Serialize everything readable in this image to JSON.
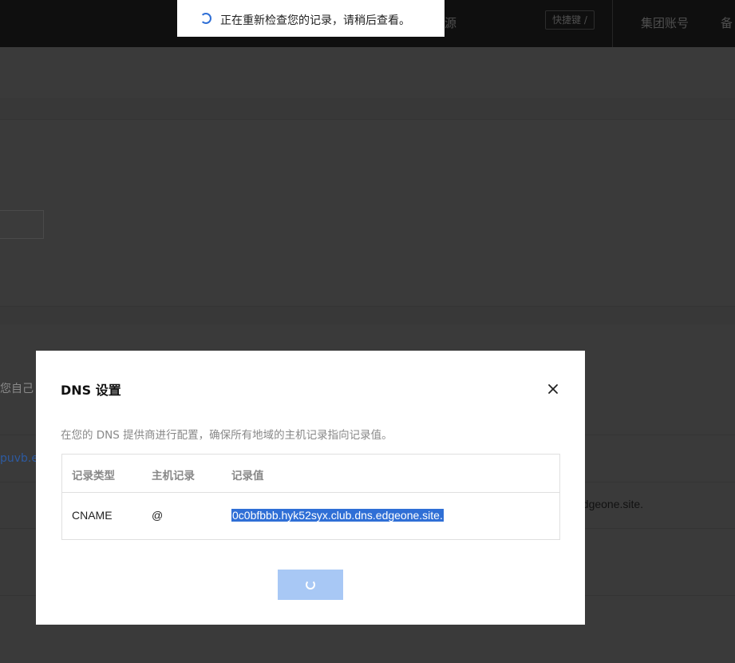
{
  "topnav": {
    "fragment": "源",
    "shortcut_label": "快捷键 /",
    "group_account": "集团账号",
    "beian": "备"
  },
  "background": {
    "text_fragment": "您自己",
    "link_fragment": "puvb.ec",
    "row_value_fragment": "edgeone.site."
  },
  "toast": {
    "icon": "loading-spinner-icon",
    "message": "正在重新检查您的记录，请稍后查看。"
  },
  "modal": {
    "title": "DNS 设置",
    "close_icon": "close-icon",
    "description": "在您的 DNS 提供商进行配置，确保所有地域的主机记录指向记录值。",
    "table": {
      "columns": [
        "记录类型",
        "主机记录",
        "记录值"
      ],
      "rows": [
        {
          "type": "CNAME",
          "host": "@",
          "value": "0c0bfbbb.hyk52syx.club.dns.edgeone.site."
        }
      ]
    },
    "confirm_button": {
      "state": "loading",
      "color": "#a8c8f5"
    }
  },
  "colors": {
    "accent": "#2f6fd6",
    "overlay": "#3a3a3a"
  }
}
